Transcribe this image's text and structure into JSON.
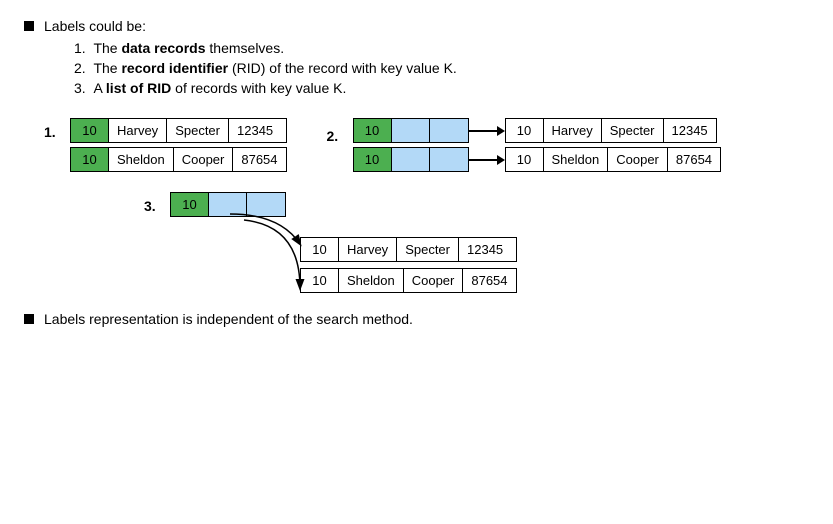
{
  "bullets": {
    "top": {
      "text": "Labels could be:"
    },
    "items": [
      {
        "number": "1.",
        "bold": "data records",
        "rest": " themselves."
      },
      {
        "number": "2.",
        "bold": "record identifier",
        "rest": " (RID) of the record with key value K."
      },
      {
        "number": "3.",
        "prefix": "A ",
        "bold": "list of RID",
        "rest": " of records with key value K."
      }
    ],
    "bottom": {
      "text": "Labels representation is independent of the search method."
    }
  },
  "diagram1": {
    "label": "1.",
    "rows": [
      [
        {
          "text": "10",
          "style": "green"
        },
        {
          "text": "Harvey",
          "style": "white"
        },
        {
          "text": "Specter",
          "style": "white"
        },
        {
          "text": "12345",
          "style": "white"
        }
      ],
      [
        {
          "text": "10",
          "style": "green"
        },
        {
          "text": "Sheldon",
          "style": "white"
        },
        {
          "text": "Cooper",
          "style": "white"
        },
        {
          "text": "87654",
          "style": "white"
        }
      ]
    ]
  },
  "diagram2": {
    "label": "2.",
    "leftRows": [
      [
        {
          "text": "10",
          "style": "green"
        },
        {
          "text": "",
          "style": "blue"
        },
        {
          "text": "",
          "style": "blue"
        }
      ],
      [
        {
          "text": "10",
          "style": "green"
        },
        {
          "text": "",
          "style": "blue"
        },
        {
          "text": "",
          "style": "blue"
        }
      ]
    ],
    "rightRows": [
      [
        {
          "text": "10",
          "style": "white"
        },
        {
          "text": "Harvey",
          "style": "white"
        },
        {
          "text": "Specter",
          "style": "white"
        },
        {
          "text": "12345",
          "style": "white"
        }
      ],
      [
        {
          "text": "10",
          "style": "white"
        },
        {
          "text": "Sheldon",
          "style": "white"
        },
        {
          "text": "Cooper",
          "style": "white"
        },
        {
          "text": "87654",
          "style": "white"
        }
      ]
    ]
  },
  "diagram3": {
    "label": "3.",
    "keyCell": "10",
    "slots": 2,
    "rightRows": [
      [
        {
          "text": "10",
          "style": "white"
        },
        {
          "text": "Harvey",
          "style": "white"
        },
        {
          "text": "Specter",
          "style": "white"
        },
        {
          "text": "12345",
          "style": "white"
        }
      ],
      [
        {
          "text": "10",
          "style": "white"
        },
        {
          "text": "Sheldon",
          "style": "white"
        },
        {
          "text": "Cooper",
          "style": "white"
        },
        {
          "text": "87654",
          "style": "white"
        }
      ]
    ]
  }
}
